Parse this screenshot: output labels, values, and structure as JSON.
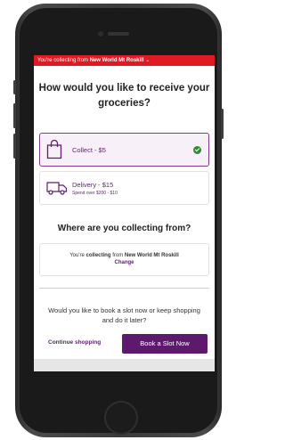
{
  "banner": {
    "prefix": "You're collecting from",
    "store": "New World Mt Roskill",
    "chevron": "⌄"
  },
  "page": {
    "title": "How would you like to receive your groceries?"
  },
  "options": {
    "collect": {
      "label": "Collect - $5",
      "icon": "shopping-bag-icon",
      "selected": true
    },
    "delivery": {
      "label": "Delivery - $15",
      "sub": "Spend over $200 - $10",
      "icon": "delivery-truck-icon",
      "selected": false
    }
  },
  "collecting": {
    "title": "Where are you collecting from?",
    "prefix": "You're",
    "collecting_word": "collecting",
    "from": "from",
    "store": "New World Mt Roskill",
    "change_label": "Change"
  },
  "booking": {
    "question": "Would you like to book a slot now or keep shopping and do it later?",
    "continue_label": "Continue shopping",
    "book_label": "Book a Slot Now"
  },
  "colors": {
    "banner": "#e01a22",
    "brand_purple": "#5d1a6c",
    "check_green": "#2f8a34"
  }
}
